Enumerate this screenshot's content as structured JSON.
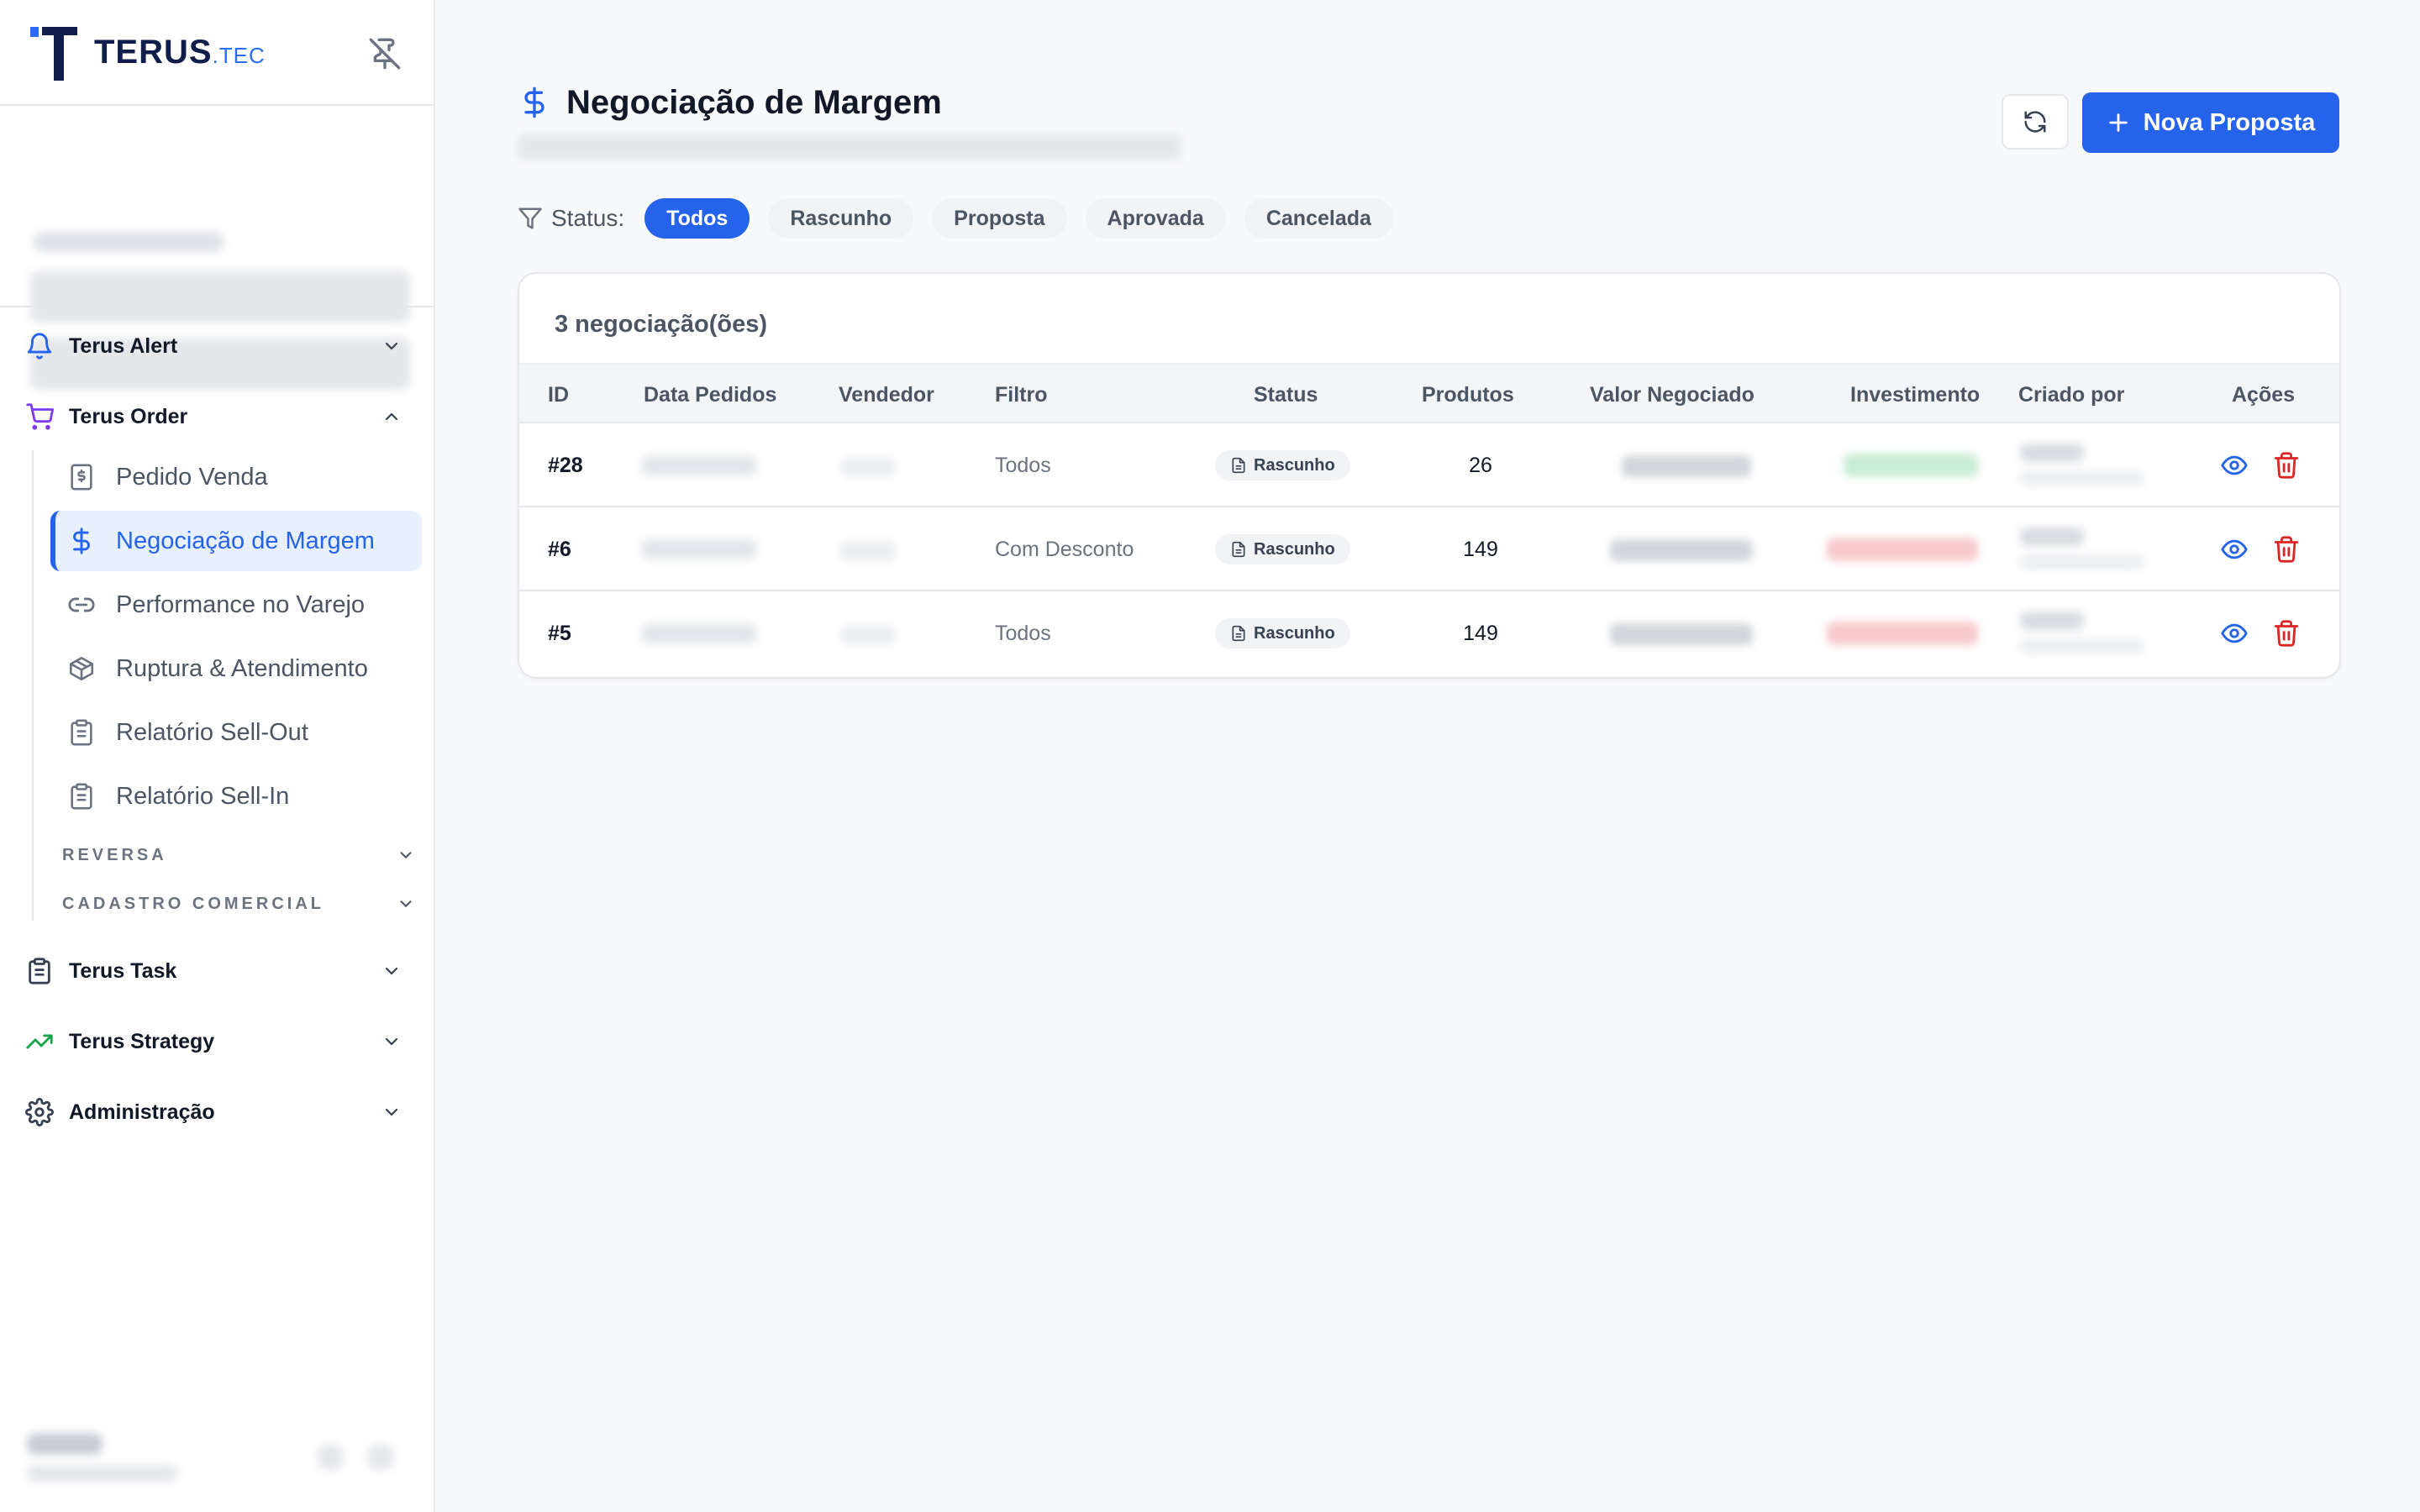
{
  "brand": {
    "name": "TERUS",
    "suffix": ".TEC"
  },
  "sidebar": {
    "groups": [
      {
        "label": "Terus Alert",
        "icon": "bell-icon"
      },
      {
        "label": "Terus Order",
        "icon": "cart-icon"
      },
      {
        "label": "Terus Task",
        "icon": "clipboard-icon"
      },
      {
        "label": "Terus Strategy",
        "icon": "trending-up-icon"
      },
      {
        "label": "Administração",
        "icon": "gear-icon"
      }
    ],
    "order_items": [
      {
        "label": "Pedido Venda",
        "icon": "receipt-icon"
      },
      {
        "label": "Negociação de Margem",
        "icon": "dollar-icon"
      },
      {
        "label": "Performance no Varejo",
        "icon": "link-icon"
      },
      {
        "label": "Ruptura & Atendimento",
        "icon": "box-icon"
      },
      {
        "label": "Relatório Sell-Out",
        "icon": "clipboard-icon"
      },
      {
        "label": "Relatório Sell-In",
        "icon": "clipboard-icon"
      }
    ],
    "sections": [
      "REVERSA",
      "CADASTRO COMERCIAL"
    ]
  },
  "header": {
    "title": "Negociação de Margem",
    "new_button": "Nova Proposta"
  },
  "filter": {
    "label": "Status:",
    "chips": [
      "Todos",
      "Rascunho",
      "Proposta",
      "Aprovada",
      "Cancelada"
    ],
    "active": "Todos"
  },
  "table": {
    "count": "3 negociação(ões)",
    "columns": [
      "ID",
      "Data Pedidos",
      "Vendedor",
      "Filtro",
      "Status",
      "Produtos",
      "Valor Negociado",
      "Investimento",
      "Criado por",
      "Ações"
    ],
    "rows": [
      {
        "id": "#28",
        "filtro": "Todos",
        "status": "Rascunho",
        "produtos": "26"
      },
      {
        "id": "#6",
        "filtro": "Com Desconto",
        "status": "Rascunho",
        "produtos": "149"
      },
      {
        "id": "#5",
        "filtro": "Todos",
        "status": "Rascunho",
        "produtos": "149"
      }
    ]
  },
  "colors": {
    "accent": "#2563eb",
    "danger": "#dc2626",
    "positive": "#16a34a"
  }
}
